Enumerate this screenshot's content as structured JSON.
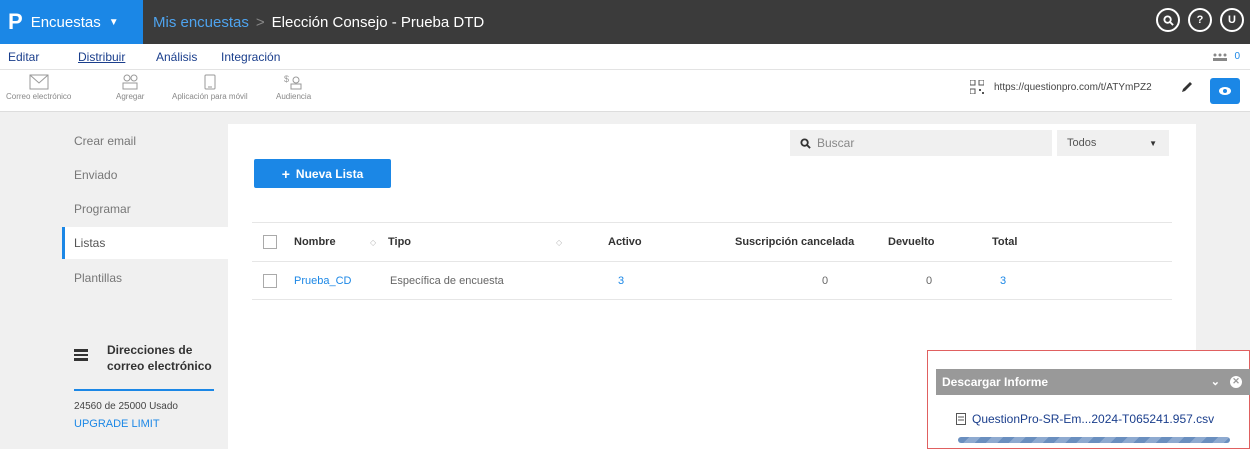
{
  "header": {
    "brand_logo": "P",
    "brand_name": "Encuestas",
    "breadcrumb_parent": "Mis encuestas",
    "breadcrumb_separator": ">",
    "breadcrumb_current": "Elección Consejo - Prueba DTD",
    "icons": [
      "search-icon",
      "help-icon",
      "user-icon"
    ],
    "user_initial": "U"
  },
  "menu": {
    "items": [
      "Editar",
      "Distribuir",
      "Análisis",
      "Integración"
    ],
    "active": "Distribuir",
    "users_count": "0"
  },
  "toolbar": {
    "tools": [
      {
        "label": "Correo electrónico",
        "icon": "email-icon"
      },
      {
        "label": "Agregar",
        "icon": "people-icon"
      },
      {
        "label": "Aplicación para móvil",
        "icon": "mobile-icon"
      },
      {
        "label": "Audiencia",
        "icon": "audience-icon"
      }
    ],
    "url": "https://questionpro.com/t/ATYmPZ2"
  },
  "sidebar": {
    "items": [
      "Crear email",
      "Enviado",
      "Programar",
      "Listas",
      "Plantillas"
    ],
    "active": "Listas",
    "addresses_title": "Direcciones de correo electrónico",
    "usage_text": "24560 de 25000 Usado",
    "upgrade_label": "UPGRADE LIMIT"
  },
  "main": {
    "search_placeholder": "Buscar",
    "filter_value": "Todos",
    "new_list_label": "Nueva Lista",
    "columns": [
      "Nombre",
      "Tipo",
      "Activo",
      "Suscripción cancelada",
      "Devuelto",
      "Total"
    ],
    "rows": [
      {
        "nombre": "Prueba_CD",
        "tipo": "Específica de encuesta",
        "activo": "3",
        "cancelada": "0",
        "devuelto": "0",
        "total": "3"
      }
    ]
  },
  "download": {
    "title": "Descargar Informe",
    "file": "QuestionPro-SR-Em...2024-T065241.957.csv"
  },
  "colors": {
    "accent": "#1b87e6",
    "topbar": "#3b3b3b",
    "link_dark": "#1a3e8c"
  }
}
